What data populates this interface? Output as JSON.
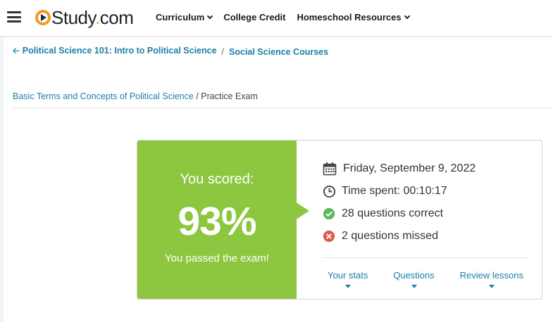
{
  "header": {
    "logo": "Study.com",
    "nav": [
      {
        "label": "Curriculum",
        "dropdown": true
      },
      {
        "label": "College Credit",
        "dropdown": false
      },
      {
        "label": "Homeschool Resources",
        "dropdown": true
      }
    ]
  },
  "breadcrumb_top": {
    "course": "Political Science 101: Intro to Political Science",
    "separator": "/",
    "category": "Social Science Courses"
  },
  "breadcrumb_sub": {
    "chapter": "Basic Terms and Concepts of Political Science",
    "separator": "/",
    "current": "Practice Exam"
  },
  "result": {
    "scored_label": "You scored:",
    "score": "93%",
    "pass_message": "You passed the exam!",
    "date": "Friday, September 9, 2022",
    "time_spent": "Time spent: 00:10:17",
    "correct": "28 questions correct",
    "missed": "2 questions missed",
    "tabs": [
      "Your stats",
      "Questions",
      "Review lessons"
    ]
  },
  "colors": {
    "brand_orange": "#f29a1f",
    "pass_green": "#8dc63f",
    "link_blue": "#1a7fa8",
    "correct_green": "#5cb85c",
    "missed_red": "#e05a4b"
  },
  "icons": {
    "menu": "hamburger-icon",
    "date": "calendar-icon",
    "time": "clock-icon",
    "correct": "check-circle-icon",
    "missed": "x-circle-icon",
    "back": "arrow-left-icon"
  }
}
